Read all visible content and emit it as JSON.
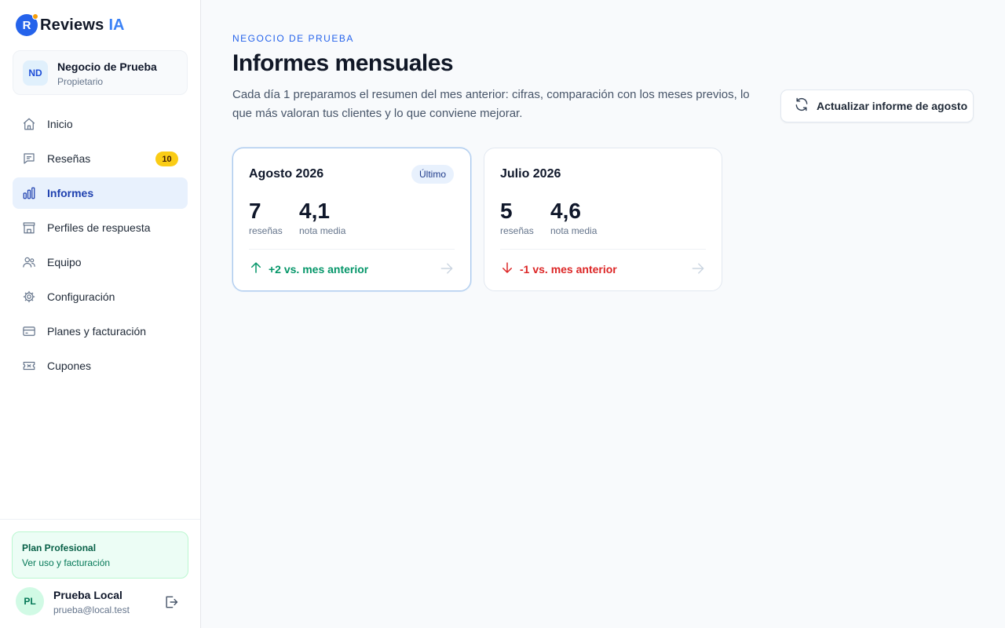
{
  "brand": {
    "logo_letter": "R",
    "name": "Reviews",
    "accent": "IA"
  },
  "business": {
    "initials": "ND",
    "name": "Negocio de Prueba",
    "role": "Propietario"
  },
  "nav": [
    {
      "label": "Inicio",
      "icon": "home-icon"
    },
    {
      "label": "Reseñas",
      "icon": "chat-icon",
      "badge": "10"
    },
    {
      "label": "Informes",
      "icon": "bar-chart-icon",
      "active": true
    },
    {
      "label": "Perfiles de respuesta",
      "icon": "store-icon"
    },
    {
      "label": "Equipo",
      "icon": "users-icon"
    },
    {
      "label": "Configuración",
      "icon": "gear-icon"
    },
    {
      "label": "Planes y facturación",
      "icon": "credit-card-icon"
    },
    {
      "label": "Cupones",
      "icon": "ticket-icon"
    }
  ],
  "plan": {
    "name": "Plan Profesional",
    "link": "Ver uso y facturación"
  },
  "user": {
    "initials": "PL",
    "name": "Prueba Local",
    "email": "prueba@local.test"
  },
  "header": {
    "eyebrow": "NEGOCIO DE PRUEBA",
    "title": "Informes mensuales",
    "description": "Cada día 1 preparamos el resumen del mes anterior: cifras, comparación con los meses previos, lo que más valoran tus clientes y lo que conviene mejorar.",
    "refresh_label": "Actualizar informe de agosto"
  },
  "reports": [
    {
      "title": "Agosto 2026",
      "badge": "Último",
      "reviews": "7",
      "reviews_label": "reseñas",
      "rating": "4,1",
      "rating_label": "nota media",
      "trend": "+2 vs. mes anterior",
      "trend_dir": "up"
    },
    {
      "title": "Julio 2026",
      "reviews": "5",
      "reviews_label": "reseñas",
      "rating": "4,6",
      "rating_label": "nota media",
      "trend": "-1 vs. mes anterior",
      "trend_dir": "down"
    }
  ],
  "colors": {
    "accent": "#2563eb",
    "badge_yellow": "#facc15",
    "positive": "#059669",
    "negative": "#dc2626"
  }
}
